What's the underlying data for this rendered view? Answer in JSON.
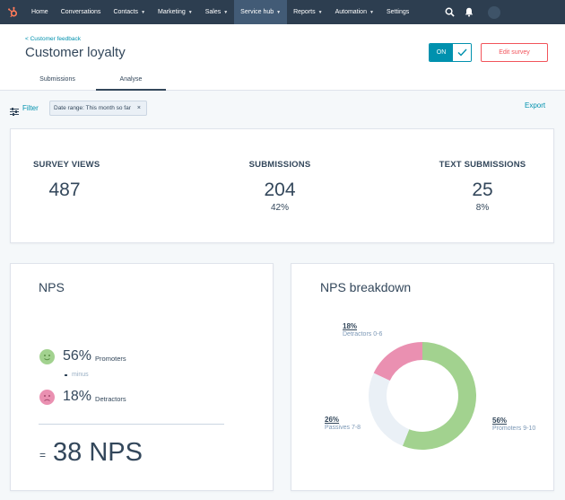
{
  "nav": {
    "items": [
      {
        "label": "Home",
        "caret": false
      },
      {
        "label": "Conversations",
        "caret": false
      },
      {
        "label": "Contacts",
        "caret": true
      },
      {
        "label": "Marketing",
        "caret": true
      },
      {
        "label": "Sales",
        "caret": true
      },
      {
        "label": "Service hub",
        "caret": true,
        "active": true
      },
      {
        "label": "Reports",
        "caret": true
      },
      {
        "label": "Automation",
        "caret": true
      },
      {
        "label": "Settings",
        "caret": false
      }
    ],
    "icons": [
      "search-icon",
      "bell-icon"
    ]
  },
  "header": {
    "breadcrumb": "< Customer feedback",
    "title": "Customer loyalty",
    "toggle_label": "ON",
    "edit_label": "Edit survey",
    "tabs": [
      "Submissions",
      "Analyse"
    ],
    "active_tab": "Analyse"
  },
  "filter": {
    "label": "Filter",
    "chip": "Date range: This month so far",
    "chip_close": "×",
    "export_label": "Export"
  },
  "stats": [
    {
      "label": "SURVEY VIEWS",
      "value": "487",
      "sub": ""
    },
    {
      "label": "SUBMISSIONS",
      "value": "204",
      "sub": "42%"
    },
    {
      "label": "TEXT SUBMISSIONS",
      "value": "25",
      "sub": "8%"
    }
  ],
  "nps": {
    "title": "NPS",
    "promoters_pct": "56%",
    "promoters_label": "Promoters",
    "minus_label": "minus",
    "detractors_pct": "18%",
    "detractors_label": "Detractors",
    "equals": "=",
    "score": "38 NPS"
  },
  "breakdown": {
    "title": "NPS breakdown",
    "segments": [
      {
        "pct": "18%",
        "label": "Detractors 0-6",
        "value": 18,
        "color": "#ea90b1"
      },
      {
        "pct": "26%",
        "label": "Passives 7-8",
        "value": 26,
        "color": "#eaf0f6"
      },
      {
        "pct": "56%",
        "label": "Promoters 9-10",
        "value": 56,
        "color": "#a2d28f"
      }
    ]
  },
  "colors": {
    "nav_bg": "#2d3e50",
    "accent": "#0091ae",
    "edit": "#f2545b",
    "promoter_face": "#a2d28f",
    "detractor_face": "#ea90b1"
  }
}
